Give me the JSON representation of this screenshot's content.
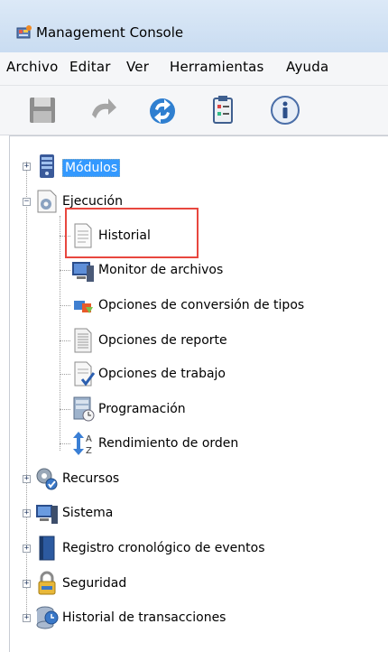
{
  "window": {
    "title": "Management Console"
  },
  "menu": {
    "items": [
      "Archivo",
      "Editar",
      "Ver",
      "Herramientas",
      "Ayuda"
    ]
  },
  "toolbar": {
    "buttons": [
      "save-icon",
      "undo-icon",
      "refresh-icon",
      "clipboard-icon",
      "info-icon"
    ]
  },
  "tree": {
    "modulos": "Módulos",
    "ejecucion": "Ejecución",
    "ejecucion_children": [
      "Historial",
      "Monitor de archivos",
      "Opciones de conversión de tipos",
      "Opciones de reporte",
      "Opciones de trabajo",
      "Programación",
      "Rendimiento de orden"
    ],
    "others": [
      "Recursos",
      "Sistema",
      "Registro cronológico de eventos",
      "Seguridad",
      "Historial de transacciones"
    ]
  },
  "colors": {
    "selection": "#3399ff",
    "highlight": "#e8473f",
    "titlebar": "#dce9f7"
  }
}
